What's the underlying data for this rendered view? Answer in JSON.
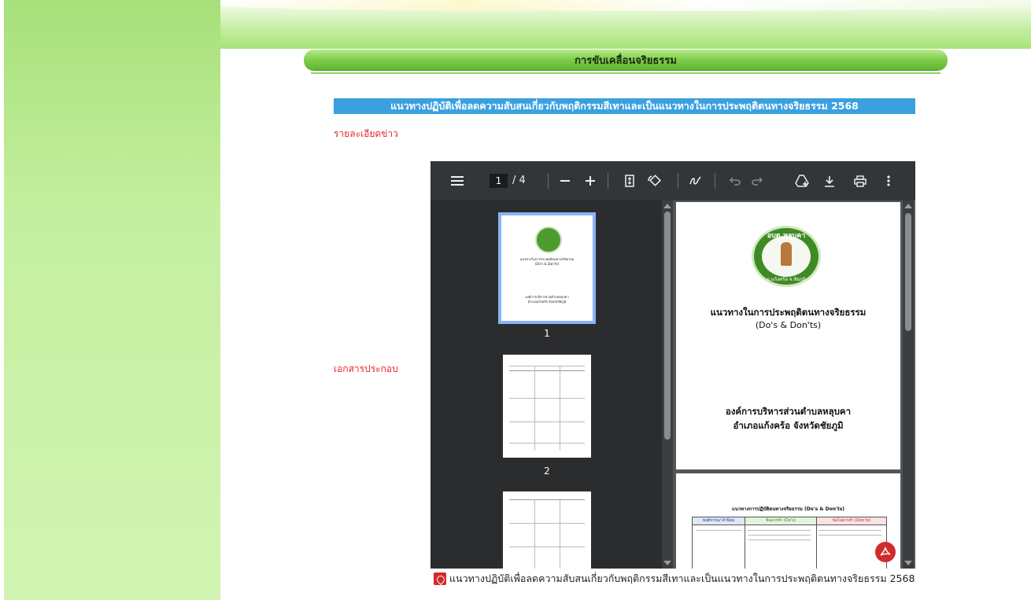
{
  "section": {
    "title": "การขับเคลื่อนจริยธรรม"
  },
  "article": {
    "title": "แนวทางปฏิบัติเพื่อลดความสับสนเกี่ยวกับพฤติกรรมสีเทาและเป็นแนวทางในการประพฤติตนทางจริยธรรม 2568",
    "details_label": "รายละเอียดข่าว",
    "attachments_label": "เอกสารประกอบ"
  },
  "viewer": {
    "current_page": "1",
    "total_pages": "/ 4",
    "icons": {
      "menu": "menu-icon",
      "zoom_out": "minus-icon",
      "zoom_in": "plus-icon",
      "fit": "fit-page-icon",
      "rotate": "rotate-icon",
      "annotate": "draw-icon",
      "undo": "undo-icon",
      "redo": "redo-icon",
      "drive": "save-to-drive-icon",
      "download": "download-icon",
      "print": "print-icon",
      "more": "more-vert-icon"
    },
    "thumbnails": [
      {
        "number": "1",
        "title": "แนวทางในการประพฤติตนทางจริยธรรม",
        "subtitle": "(Do's & Don'ts)",
        "org": "องค์การบริหารส่วนตำบลหลุบคา",
        "district": "อำเภอแก้งคร้อ จังหวัดชัยภูมิ"
      },
      {
        "number": "2"
      },
      {
        "number": ""
      }
    ],
    "page1": {
      "seal_text": "อบต.หลุบคา",
      "seal_bottom": "อ.แก้งคร้อ จ.ชัยภูมิ",
      "title": "แนวทางในการประพฤติตนทางจริยธรรม",
      "subtitle": "(Do's & Don'ts)",
      "org": "องค์การบริหารส่วนตำบลหลุบคา",
      "district": "อำเภอแก้งคร้อ  จังหวัดชัยภูมิ"
    },
    "page2": {
      "title": "แนวทางการปฏิบัติตนทางจริยธรรม (Do's & Don'ts)",
      "col1": "พฤติกรรม/ คำนิยม",
      "col2": "ข้อควรทำ (Do's)",
      "col3": "ข้อไม่ควรทำ (Don'ts)"
    }
  },
  "attachment": {
    "link_text": "แนวทางปฏิบัติเพื่อลดความสับสนเกี่ยวกับพฤติกรรมสีเทาและเป็นแนวทางในการประพฤติตนทางจริยธรรม 2568",
    "icon": "pdf-icon"
  },
  "colors": {
    "accent_green": "#7fcc4c",
    "title_blue": "#3aa0e0",
    "label_red": "#e8262c",
    "toolbar": "#323639"
  }
}
